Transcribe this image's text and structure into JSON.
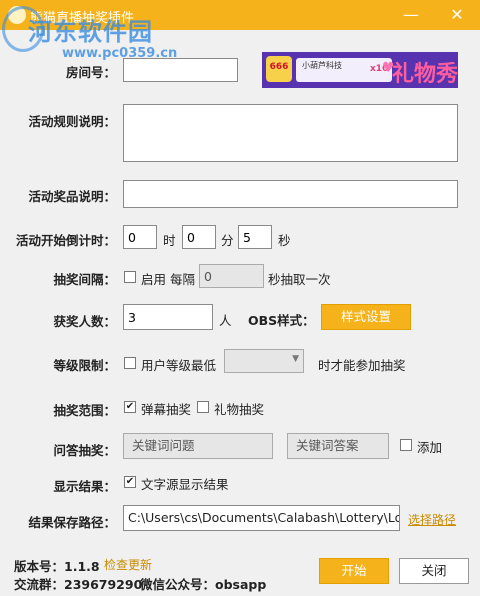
{
  "window": {
    "title": "熊猫直播抽奖插件",
    "minimize_glyph": "—",
    "close_glyph": "✕"
  },
  "watermark": {
    "text": "河东软件园",
    "url": "www.pc0359.cn"
  },
  "banner": {
    "badge": "666",
    "name": "小葫芦科技",
    "multiplier": "x10",
    "big_text": "礼物秀",
    "heart": "♥"
  },
  "room": {
    "label": "房间号：",
    "value": ""
  },
  "rules": {
    "label": "活动规则说明：",
    "value": ""
  },
  "prizes": {
    "label": "活动奖品说明：",
    "value": ""
  },
  "countdown": {
    "label": "活动开始倒计时：",
    "hours": "0",
    "hours_unit": "时",
    "minutes": "0",
    "minutes_unit": "分",
    "seconds": "5",
    "seconds_unit": "秒"
  },
  "interval": {
    "label": "抽奖间隔：",
    "enable_label": "启用 每隔",
    "enabled": false,
    "value": "0",
    "suffix": "秒抽取一次"
  },
  "winners": {
    "label": "获奖人数：",
    "value": "3",
    "unit": "人",
    "obs_label": "OBS样式：",
    "style_button": "样式设置"
  },
  "level": {
    "label": "等级限制：",
    "checkbox_label": "用户等级最低",
    "checked": false,
    "selected": "",
    "suffix": "时才能参加抽奖"
  },
  "scope": {
    "label": "抽奖范围：",
    "danmaku_label": "弹幕抽奖",
    "danmaku_checked": true,
    "gift_label": "礼物抽奖",
    "gift_checked": false
  },
  "qa": {
    "label": "问答抽奖：",
    "question_placeholder": "关键词问题",
    "answer_placeholder": "关键词答案",
    "add_label": "添加",
    "add_checked": false
  },
  "display": {
    "label": "显示结果：",
    "checkbox_label": "文字源显示结果",
    "checked": true
  },
  "save_path": {
    "label": "结果保存路径：",
    "value": "C:\\Users\\cs\\Documents\\Calabash\\Lottery\\Lot",
    "browse_link": "选择路径"
  },
  "footer": {
    "version_label": "版本号：1.1.8",
    "check_update": "检查更新",
    "group_label": "交流群：239679290",
    "wechat_label": "微信公众号：obsapp",
    "start_button": "开始",
    "close_button": "关闭"
  },
  "colors": {
    "accent": "#f6b21a",
    "link": "#c98b00"
  }
}
